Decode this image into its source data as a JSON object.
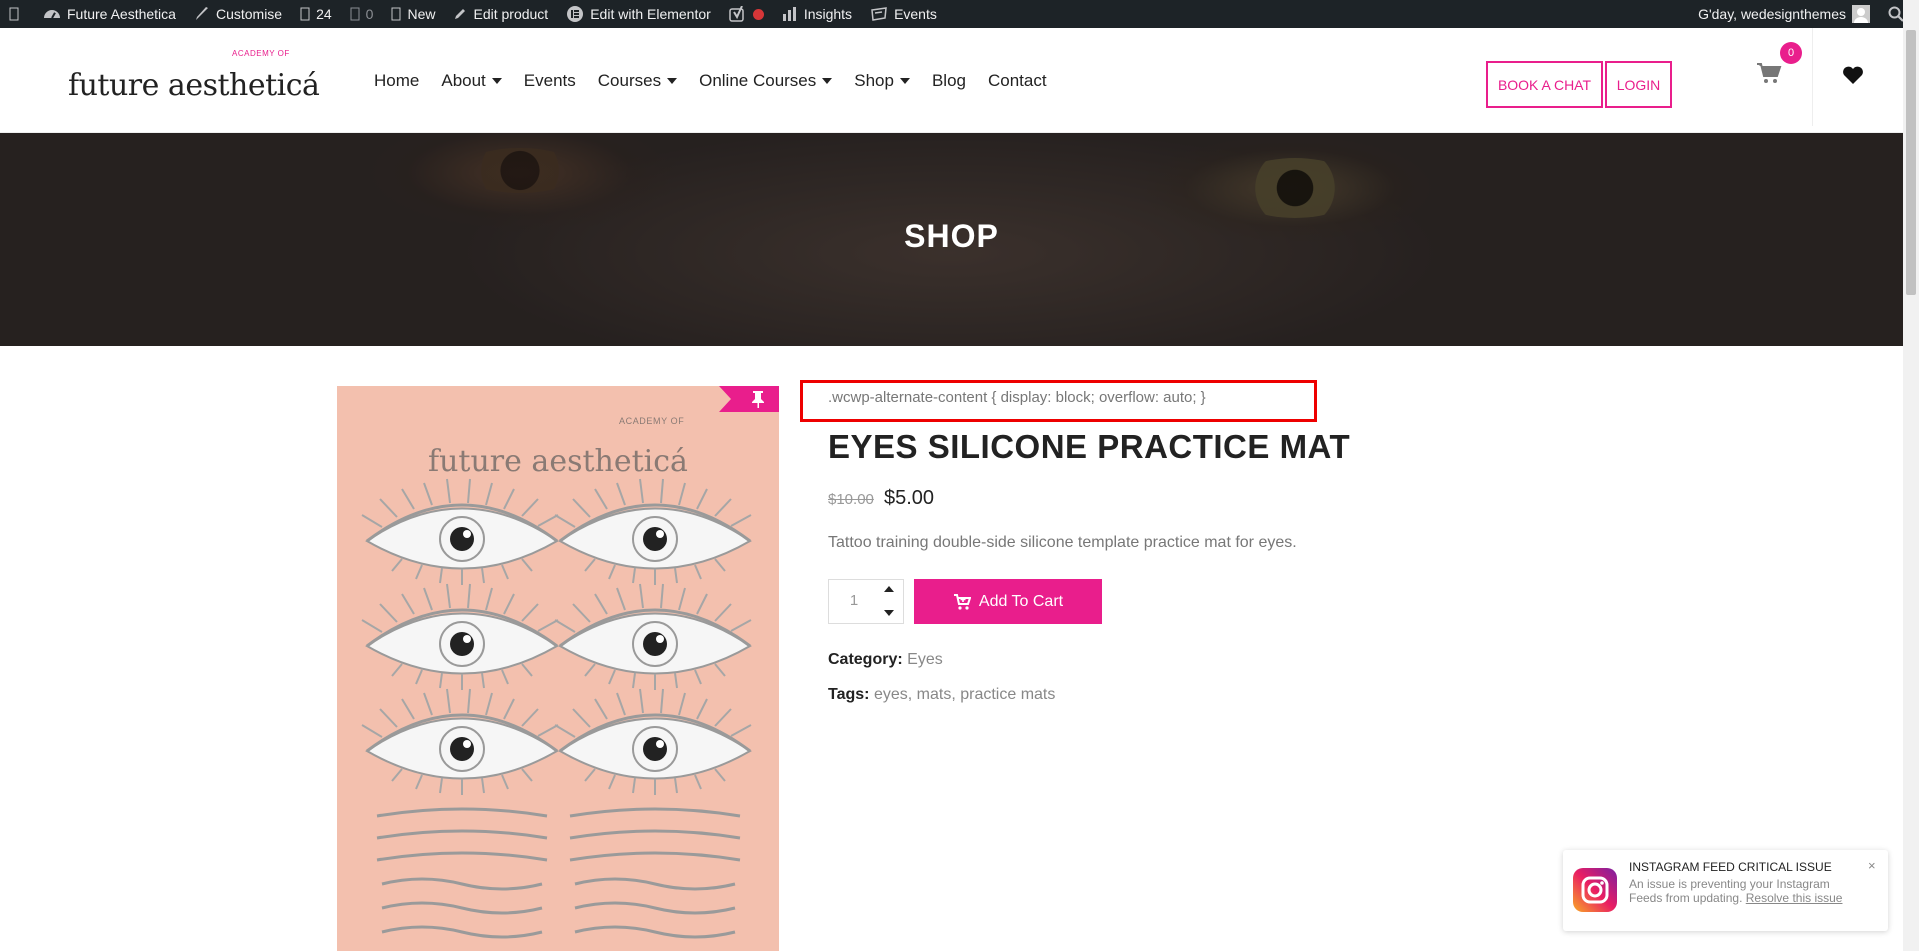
{
  "adminbar": {
    "site_name": "Future Aesthetica",
    "customise": "Customise",
    "comments_count": "24",
    "updates_count": "0",
    "new_label": "New",
    "edit_product": "Edit product",
    "edit_elementor": "Edit with Elementor",
    "insights": "Insights",
    "events": "Events",
    "greeting": "G'day, wedesignthemes"
  },
  "header": {
    "logo_small": "ACADEMY OF",
    "logo_main": "future aestheticá",
    "nav": [
      {
        "label": "Home"
      },
      {
        "label": "About"
      },
      {
        "label": "Events"
      },
      {
        "label": "Courses"
      },
      {
        "label": "Online Courses"
      },
      {
        "label": "Shop"
      },
      {
        "label": "Blog"
      },
      {
        "label": "Contact"
      }
    ],
    "book_chat": "BOOK A CHAT",
    "login": "LOGIN",
    "cart_count": "0"
  },
  "hero": {
    "title": "SHOP"
  },
  "product": {
    "image_small": "ACADEMY OF",
    "image_title": "future aestheticá",
    "css_notice": ".wcwp-alternate-content { display: block; overflow: auto; }",
    "title": "EYES SILICONE PRACTICE MAT",
    "price_old": "$10.00",
    "price_new": "$5.00",
    "description": "Tattoo training double-side silicone template practice mat for eyes.",
    "quantity": "1",
    "add_to_cart": "Add To Cart",
    "category_label": "Category:",
    "category": "Eyes",
    "tags_label": "Tags:",
    "tags": [
      "eyes",
      "mats",
      "practice mats"
    ]
  },
  "notice": {
    "title": "INSTAGRAM FEED CRITICAL ISSUE",
    "body": "An issue is preventing your Instagram Feeds from updating.",
    "link": "Resolve this issue",
    "close": "×"
  },
  "colors": {
    "accent": "#e91e8c",
    "adminbar": "#1d2327",
    "mat_bg": "#f3c0ae"
  }
}
